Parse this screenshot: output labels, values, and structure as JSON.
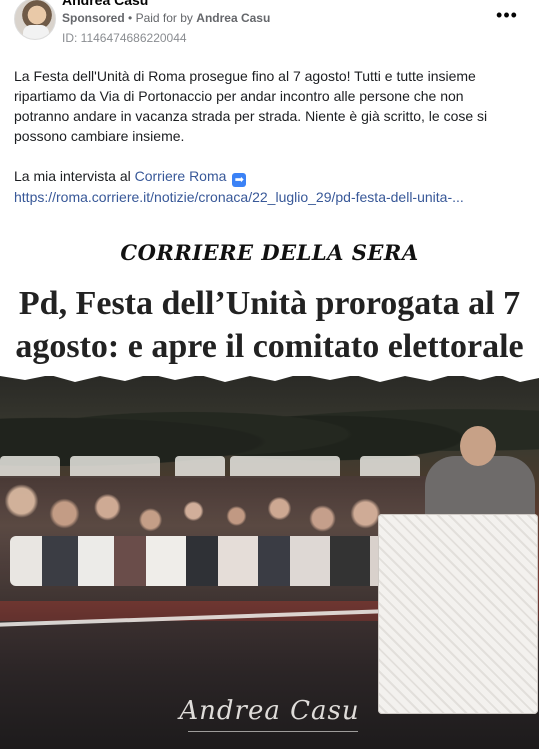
{
  "post": {
    "page_name": "Andrea Casu",
    "sponsored_label": "Sponsored",
    "separator": "•",
    "paid_for_prefix": "Paid for by",
    "paid_for_name": "Andrea Casu",
    "ad_id": "ID: 1146474686220044",
    "more_icon": "•••",
    "body_paragraph": "La Festa dell'Unità di Roma prosegue fino al 7 agosto! Tutti e tutte insieme ripartiamo da Via di Portonaccio per andar incontro alle persone che non potranno andare in vacanza strada per strada. Niente è già scritto, le cose si possono cambiare insieme.",
    "interview_prefix": "La mia intervista al",
    "interview_link": "Corriere Roma",
    "arrow_emoji": "➡",
    "url": "https://roma.corriere.it/notizie/cronaca/22_luglio_29/pd-festa-dell-unita-..."
  },
  "creative": {
    "masthead": "CORRIERE DELLA SERA",
    "headline_line1": "Pd, Festa dell’Unità prorogata al 7",
    "headline_line2": "agosto: e apre il comitato elettorale",
    "signature": "Andrea Casu"
  },
  "colors": {
    "link": "#385898",
    "meta": "#65676b",
    "text": "#1c1e21"
  }
}
